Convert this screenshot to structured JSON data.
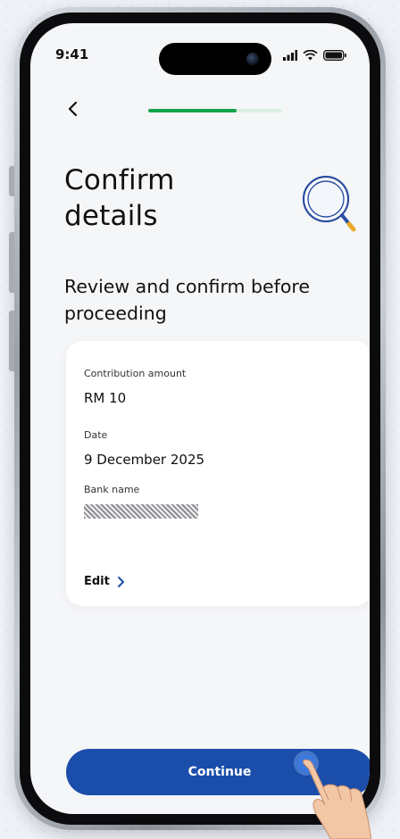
{
  "status_bar": {
    "time": "9:41"
  },
  "progress": {
    "value": 0.66
  },
  "header": {
    "title": "Confirm details",
    "subtitle": "Review and confirm before proceeding"
  },
  "details": {
    "contribution_label": "Contribution amount",
    "contribution_value": "RM 10",
    "date_label": "Date",
    "date_value": "9 December 2025",
    "bank_label": "Bank name",
    "edit_label": "Edit"
  },
  "footer": {
    "continue_label": "Continue"
  },
  "colors": {
    "primary": "#1b4eab",
    "progress": "#10a34a",
    "progress_track": "#d8efe1",
    "accent": "#e7a92a"
  },
  "icons": [
    "back-chevron-icon",
    "search-magnifier-icon",
    "chevron-right-icon",
    "signal-icon",
    "wifi-icon",
    "battery-icon"
  ]
}
